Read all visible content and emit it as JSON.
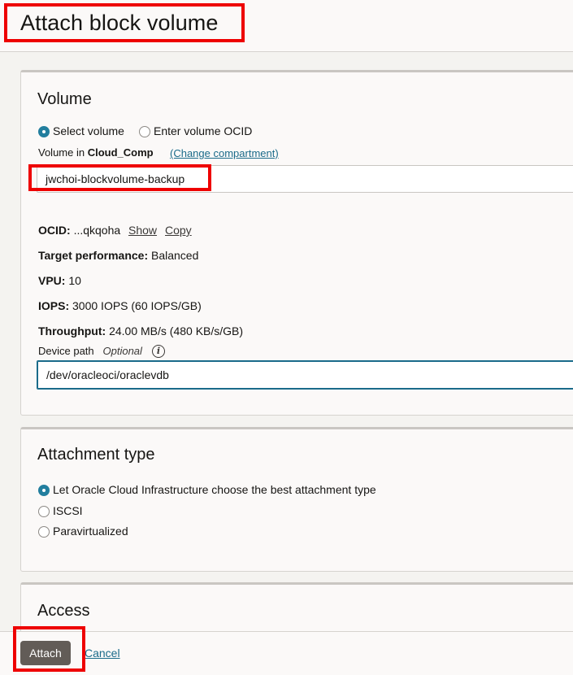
{
  "header": {
    "title": "Attach block volume"
  },
  "volume_section": {
    "title": "Volume",
    "radio_select_label": "Select volume",
    "radio_ocid_label": "Enter volume OCID",
    "volume_in_prefix": "Volume in",
    "compartment_name": "Cloud_Comp",
    "change_compartment_label": "(Change compartment)",
    "selected_volume": "jwchoi-blockvolume-backup",
    "ocid_label": "OCID:",
    "ocid_value": "...qkqoha",
    "show_label": "Show",
    "copy_label": "Copy",
    "target_performance_label": "Target performance:",
    "target_performance_value": "Balanced",
    "vpu_label": "VPU:",
    "vpu_value": "10",
    "iops_label": "IOPS:",
    "iops_value": "3000 IOPS (60 IOPS/GB)",
    "throughput_label": "Throughput:",
    "throughput_value": "24.00 MB/s (480 KB/s/GB)",
    "device_path_label": "Device path",
    "device_path_optional": "Optional",
    "info_icon_glyph": "i",
    "device_path_value": "/dev/oracleoci/oraclevdb"
  },
  "attachment_section": {
    "title": "Attachment type",
    "options": [
      {
        "label": "Let Oracle Cloud Infrastructure choose the best attachment type",
        "checked": true
      },
      {
        "label": "ISCSI",
        "checked": false
      },
      {
        "label": "Paravirtualized",
        "checked": false
      }
    ]
  },
  "access_section": {
    "title": "Access"
  },
  "footer": {
    "attach_label": "Attach",
    "cancel_label": "Cancel"
  },
  "colors": {
    "accent": "#227e9e",
    "link": "#1a6b8a",
    "highlight": "#ee0000",
    "primary_button": "#625c57"
  },
  "icons": {
    "info": "info-icon",
    "radio": "radio-icon"
  }
}
